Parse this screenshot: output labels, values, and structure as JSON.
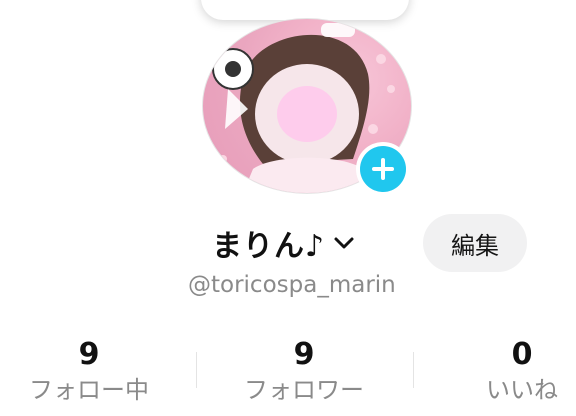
{
  "profile": {
    "display_name": "まりん♪",
    "username": "@toricospa_marin",
    "edit_label": "編集"
  },
  "stats": [
    {
      "value": "9",
      "label": "フォロー中"
    },
    {
      "value": "9",
      "label": "フォロワー"
    },
    {
      "value": "0",
      "label": "いいね"
    }
  ],
  "icons": {
    "add": "plus-icon",
    "dropdown": "chevron-down-icon"
  },
  "colors": {
    "add_badge": "#20c7ee",
    "edit_button_bg": "#f1f1f2",
    "muted_text": "#8a8a8a"
  }
}
